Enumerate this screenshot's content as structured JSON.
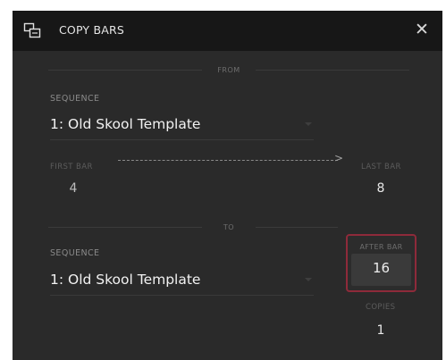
{
  "dialog": {
    "title": "COPY BARS",
    "close_icon": "close-icon",
    "title_icon": "copy-bars-icon"
  },
  "from": {
    "section_label": "FROM",
    "sequence_label": "SEQUENCE",
    "sequence_value": "1: Old Skool Template",
    "first_bar_label": "FIRST BAR",
    "first_bar_value": "4",
    "last_bar_label": "LAST BAR",
    "last_bar_value": "8"
  },
  "to": {
    "section_label": "TO",
    "sequence_label": "SEQUENCE",
    "sequence_value": "1: Old Skool Template",
    "after_bar_label": "AFTER BAR",
    "after_bar_value": "16",
    "copies_label": "COPIES",
    "copies_value": "1"
  },
  "colors": {
    "accent_border": "#8e2a3a",
    "titlebar": "#171717",
    "panel": "#2a2a2a"
  }
}
